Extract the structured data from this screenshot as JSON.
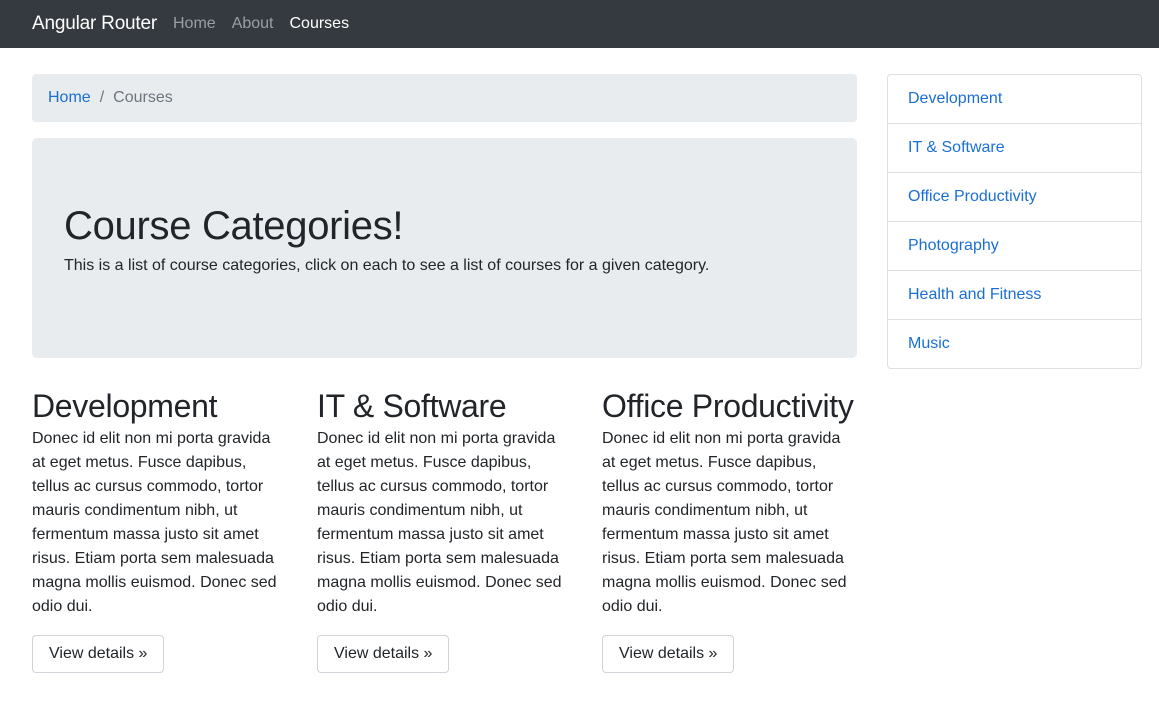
{
  "navbar": {
    "brand": "Angular Router",
    "links": [
      "Home",
      "About",
      "Courses"
    ],
    "active": "Courses"
  },
  "breadcrumb": {
    "home": "Home",
    "separator": "/",
    "current": "Courses"
  },
  "jumbotron": {
    "title": "Course Categories!",
    "subtitle": "This is a list of course categories, click on each to see a list of courses for a given category."
  },
  "categories": [
    {
      "title": "Development",
      "body": "Donec id elit non mi porta gravida at eget metus. Fusce dapibus, tellus ac cursus commodo, tortor mauris condimentum nibh, ut fermentum massa justo sit amet risus. Etiam porta sem malesuada magna mollis euismod. Donec sed odio dui.",
      "button": "View details »"
    },
    {
      "title": "IT & Software",
      "body": "Donec id elit non mi porta gravida at eget metus. Fusce dapibus, tellus ac cursus commodo, tortor mauris condimentum nibh, ut fermentum massa justo sit amet risus. Etiam porta sem malesuada magna mollis euismod. Donec sed odio dui.",
      "button": "View details »"
    },
    {
      "title": "Office Productivity",
      "body": "Donec id elit non mi porta gravida at eget metus. Fusce dapibus, tellus ac cursus commodo, tortor mauris condimentum nibh, ut fermentum massa justo sit amet risus. Etiam porta sem malesuada magna mollis euismod. Donec sed odio dui.",
      "button": "View details »"
    }
  ],
  "sidebar": {
    "items": [
      "Development",
      "IT & Software",
      "Office Productivity",
      "Photography",
      "Health and Fitness",
      "Music"
    ]
  },
  "colors": {
    "navbar_bg": "#343a40",
    "panel_bg": "#e9ecef",
    "link": "#1a6fd4"
  }
}
